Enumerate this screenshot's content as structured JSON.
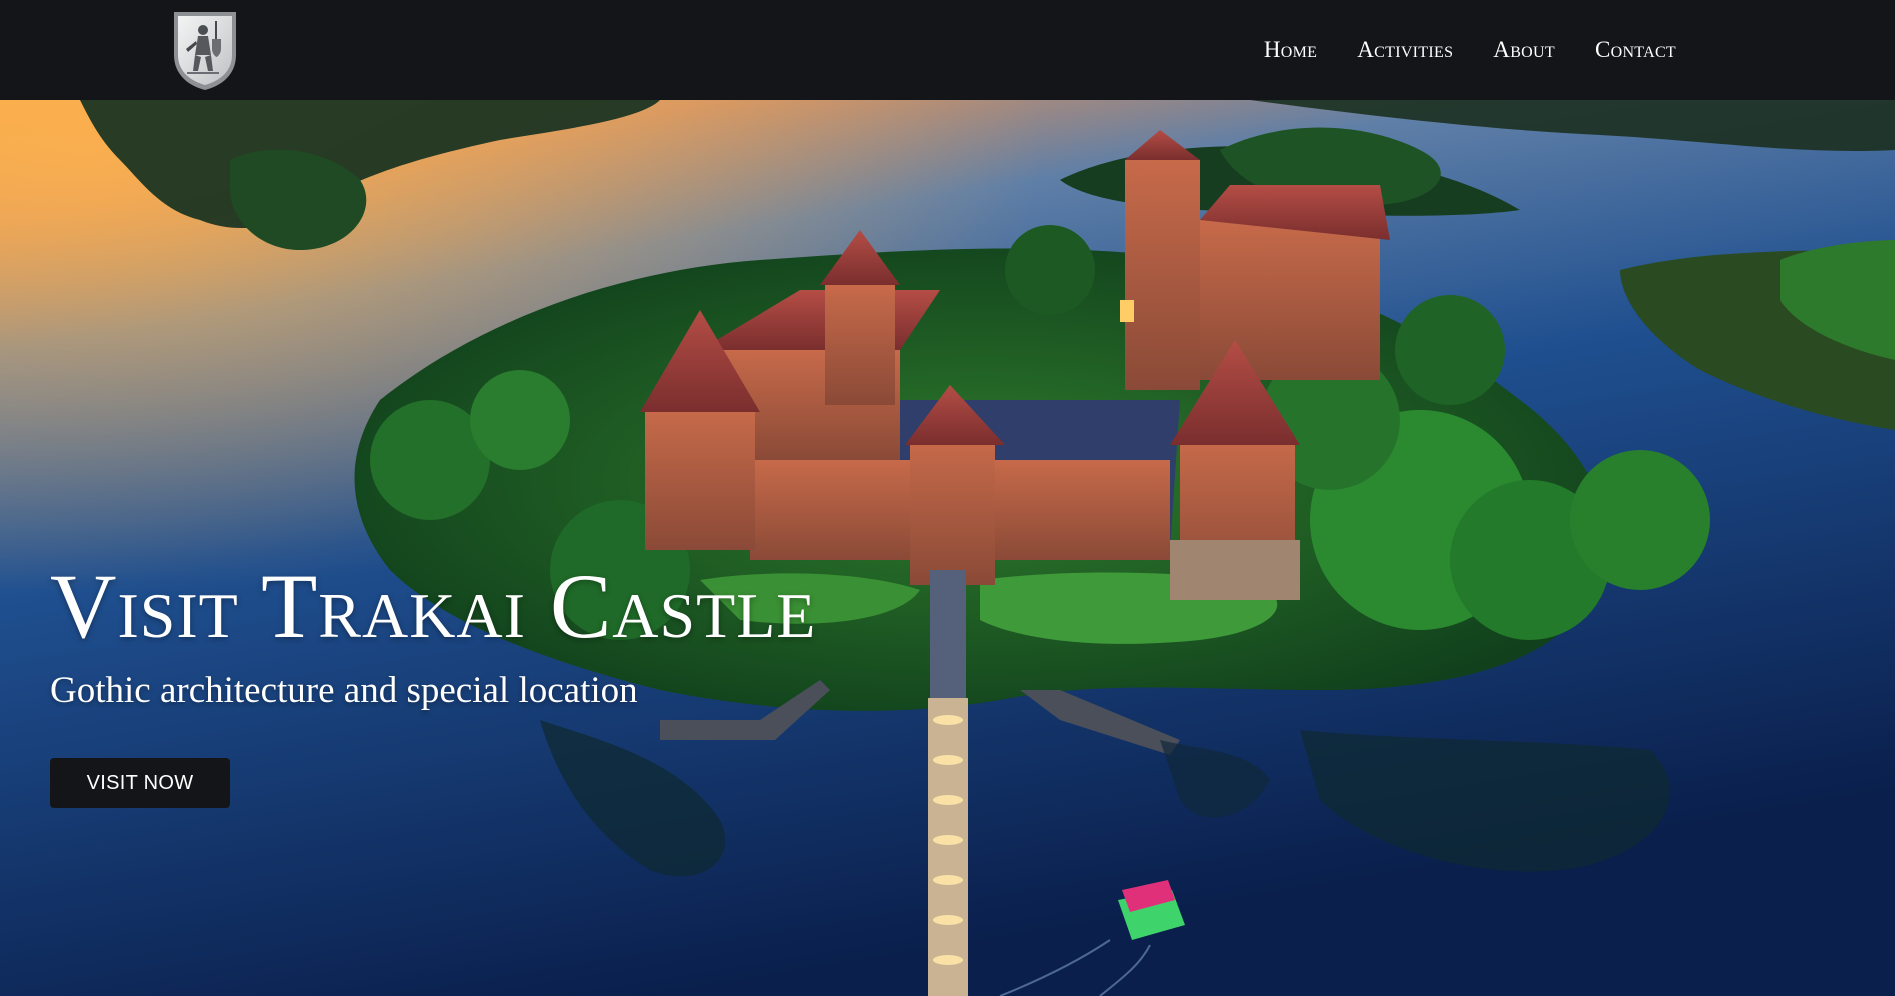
{
  "nav": {
    "logo_icon": "coat-of-arms-knight-icon",
    "links": [
      "Home",
      "Activities",
      "About",
      "Contact"
    ]
  },
  "hero": {
    "background": "aerial-photo-trakai-castle-lake-sunset",
    "title": "Visit Trakai Castle",
    "subtitle": "Gothic architecture and special location",
    "button_label": "VISIT NOW"
  },
  "colors": {
    "navbar_bg": "#131518",
    "button_bg": "#131518",
    "text": "#ffffff"
  }
}
